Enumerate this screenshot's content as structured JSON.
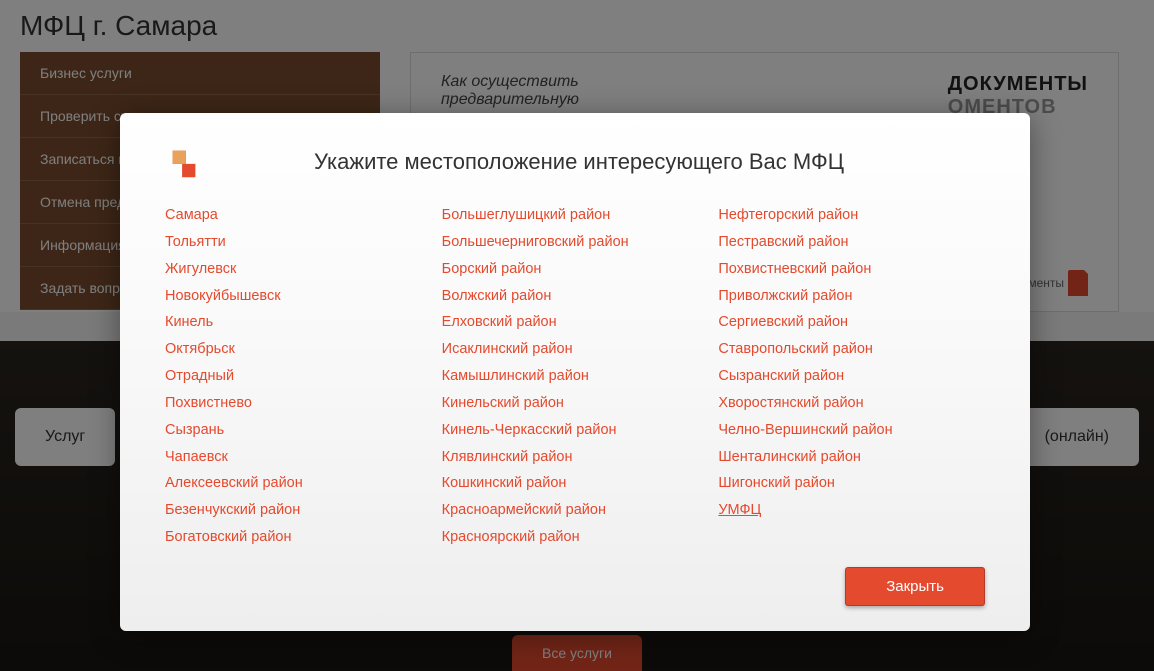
{
  "page": {
    "title": "МФЦ г. Самара"
  },
  "sidebar": {
    "items": [
      {
        "label": "Бизнес услуги"
      },
      {
        "label": "Проверить ст"
      },
      {
        "label": "Записаться н"
      },
      {
        "label": "Отмена пред"
      },
      {
        "label": "Информация"
      },
      {
        "label": "Задать вопро"
      }
    ]
  },
  "banner": {
    "text": "Как осуществить предварительную",
    "docs_label": "ДОКУМЕНТЫ",
    "docs_sub": "ОМЕНТОВ",
    "logo_text": "мои документы"
  },
  "cards": {
    "left": "Услуг",
    "right": "(онлайн)"
  },
  "all_services": "Все услуги",
  "modal": {
    "title": "Укажите местоположение интересующего Вас МФЦ",
    "close": "Закрыть",
    "col1": [
      "Самара",
      "Тольятти",
      "Жигулевск",
      "Новокуйбышевск",
      "Кинель",
      "Октябрьск",
      "Отрадный",
      "Похвистнево",
      "Сызрань",
      "Чапаевск",
      "Алексеевский район",
      "Безенчукский район",
      "Богатовский район"
    ],
    "col2": [
      "Большеглушицкий район",
      "Большечерниговский район",
      "Борский район",
      "Волжский район",
      "Елховский район",
      "Исаклинский район",
      "Камышлинский район",
      "Кинельский район",
      "Кинель-Черкасский район",
      "Клявлинский район",
      "Кошкинский район",
      "Красноармейский район",
      "Красноярский район"
    ],
    "col3": [
      "Нефтегорский район",
      "Пестравский район",
      "Похвистневский район",
      "Приволжский район",
      "Сергиевский район",
      "Ставропольский район",
      "Сызранский район",
      "Хворостянский район",
      "Челно-Вершинский район",
      "Шенталинский район",
      "Шигонский район",
      "УМФЦ"
    ]
  }
}
